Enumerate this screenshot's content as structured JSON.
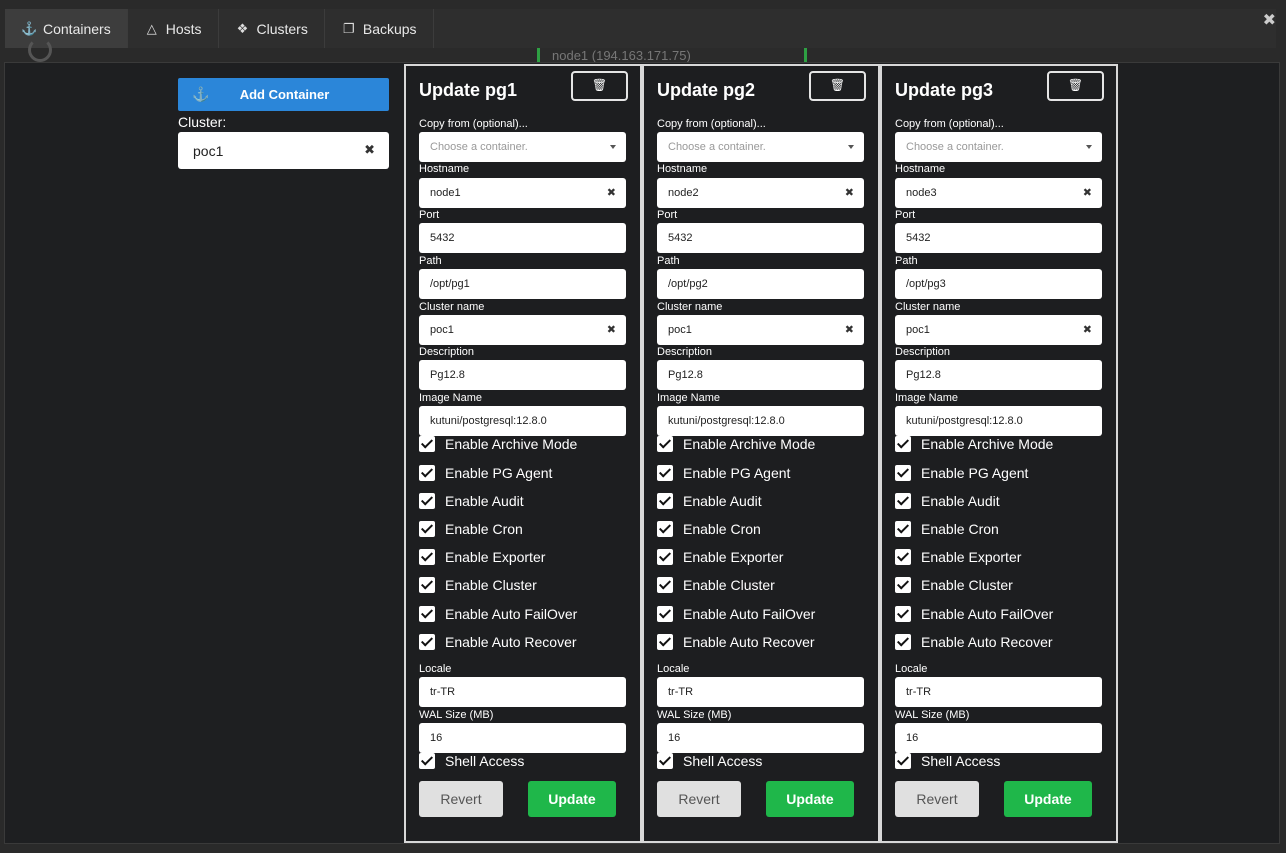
{
  "tabs": [
    {
      "label": "Containers",
      "icon": "docker-icon"
    },
    {
      "label": "Hosts",
      "icon": "linux-icon"
    },
    {
      "label": "Clusters",
      "icon": "cubes-icon"
    },
    {
      "label": "Backups",
      "icon": "copy-icon"
    }
  ],
  "background": {
    "strip_text": "node1 (194.163.171.75)"
  },
  "sidebar": {
    "add_label": "Add Container",
    "cluster_label": "Cluster:",
    "cluster_value": "poc1"
  },
  "labels": {
    "copy_from": "Copy from (optional)...",
    "copy_placeholder": "Choose a container.",
    "hostname": "Hostname",
    "port": "Port",
    "path": "Path",
    "cluster_name": "Cluster name",
    "description": "Description",
    "image_name": "Image Name",
    "locale": "Locale",
    "wal_size": "WAL Size (MB)",
    "revert": "Revert",
    "update": "Update"
  },
  "checkbox_labels": [
    "Enable Archive Mode",
    "Enable PG Agent",
    "Enable Audit",
    "Enable Cron",
    "Enable Exporter",
    "Enable Cluster",
    "Enable Auto FailOver",
    "Enable Auto Recover"
  ],
  "shell_access_label": "Shell Access",
  "panels": [
    {
      "title": "Update pg1",
      "hostname": "node1",
      "port": "5432",
      "path": "/opt/pg1",
      "cluster_name": "poc1",
      "description": "Pg12.8",
      "image_name": "kutuni/postgresql:12.8.0",
      "checkboxes": [
        true,
        true,
        true,
        true,
        true,
        true,
        true,
        true
      ],
      "locale": "tr-TR",
      "wal_size": "16",
      "shell_access": true
    },
    {
      "title": "Update pg2",
      "hostname": "node2",
      "port": "5432",
      "path": "/opt/pg2",
      "cluster_name": "poc1",
      "description": "Pg12.8",
      "image_name": "kutuni/postgresql:12.8.0",
      "checkboxes": [
        true,
        true,
        true,
        true,
        true,
        true,
        true,
        true
      ],
      "locale": "tr-TR",
      "wal_size": "16",
      "shell_access": true
    },
    {
      "title": "Update pg3",
      "hostname": "node3",
      "port": "5432",
      "path": "/opt/pg3",
      "cluster_name": "poc1",
      "description": "Pg12.8",
      "image_name": "kutuni/postgresql:12.8.0",
      "checkboxes": [
        true,
        true,
        true,
        true,
        true,
        true,
        true,
        true
      ],
      "locale": "tr-TR",
      "wal_size": "16",
      "shell_access": true
    }
  ]
}
